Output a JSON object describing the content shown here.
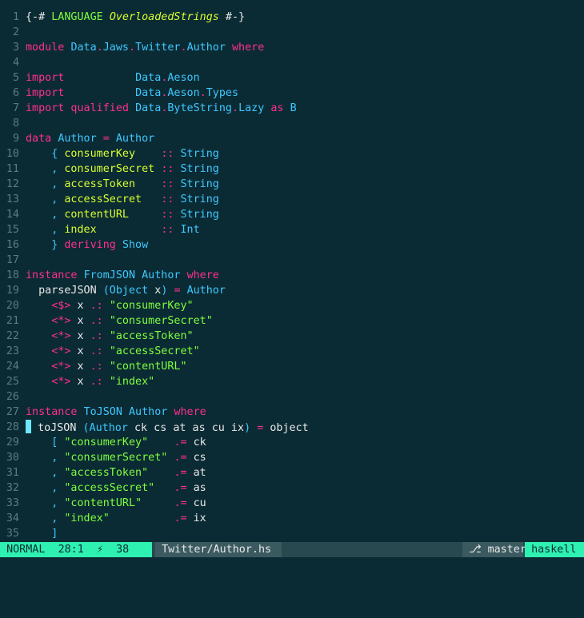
{
  "editor": {
    "lines": [
      {
        "n": "1",
        "html": "<span class=\"pr\">{-# </span><span class=\"str\">LANGUAGE</span><span class=\"pr\"> </span><span class=\"fld ital\">OverloadedStrings</span><span class=\"pr\"> #-}</span>"
      },
      {
        "n": "2",
        "html": ""
      },
      {
        "n": "3",
        "html": "<span class=\"kw\">module</span> <span class=\"ty\">Data</span><span class=\"kw\">.</span><span class=\"ty\">Jaws</span><span class=\"kw\">.</span><span class=\"ty\">Twitter</span><span class=\"kw\">.</span><span class=\"ty\">Author</span> <span class=\"kw\">where</span>"
      },
      {
        "n": "4",
        "html": ""
      },
      {
        "n": "5",
        "html": "<span class=\"kw\">import</span>           <span class=\"ty\">Data</span><span class=\"kw\">.</span><span class=\"ty\">Aeson</span>"
      },
      {
        "n": "6",
        "html": "<span class=\"kw\">import</span>           <span class=\"ty\">Data</span><span class=\"kw\">.</span><span class=\"ty\">Aeson</span><span class=\"kw\">.</span><span class=\"ty\">Types</span>"
      },
      {
        "n": "7",
        "html": "<span class=\"kw\">import qualified</span> <span class=\"ty\">Data</span><span class=\"kw\">.</span><span class=\"ty\">ByteString</span><span class=\"kw\">.</span><span class=\"ty\">Lazy</span> <span class=\"kw\">as</span> <span class=\"ty\">B</span>"
      },
      {
        "n": "8",
        "html": ""
      },
      {
        "n": "9",
        "html": "<span class=\"kw\">data</span> <span class=\"ty\">Author</span> <span class=\"kw\">=</span> <span class=\"ty\">Author</span>"
      },
      {
        "n": "10",
        "html": "    <span class=\"ty\">{</span> <span class=\"fld\">consumerKey</span>    <span class=\"kw\">::</span> <span class=\"ty\">String</span>"
      },
      {
        "n": "11",
        "html": "    <span class=\"ty\">,</span> <span class=\"fld\">consumerSecret</span> <span class=\"kw\">::</span> <span class=\"ty\">String</span>"
      },
      {
        "n": "12",
        "html": "    <span class=\"ty\">,</span> <span class=\"fld\">accessToken</span>    <span class=\"kw\">::</span> <span class=\"ty\">String</span>"
      },
      {
        "n": "13",
        "html": "    <span class=\"ty\">,</span> <span class=\"fld\">accessSecret</span>   <span class=\"kw\">::</span> <span class=\"ty\">String</span>"
      },
      {
        "n": "14",
        "html": "    <span class=\"ty\">,</span> <span class=\"fld\">contentURL</span>     <span class=\"kw\">::</span> <span class=\"ty\">String</span>"
      },
      {
        "n": "15",
        "html": "    <span class=\"ty\">,</span> <span class=\"fld\">index</span>          <span class=\"kw\">::</span> <span class=\"ty\">Int</span>"
      },
      {
        "n": "16",
        "html": "    <span class=\"ty\">}</span> <span class=\"kw\">deriving</span> <span class=\"ty\">Show</span>"
      },
      {
        "n": "17",
        "html": ""
      },
      {
        "n": "18",
        "html": "<span class=\"kw\">instance</span> <span class=\"ty\">FromJSON</span> <span class=\"ty\">Author</span> <span class=\"kw\">where</span>"
      },
      {
        "n": "19",
        "html": "  <span class=\"pr\">parseJSON</span> <span class=\"ty\">(Object</span> <span class=\"pr\">x</span><span class=\"ty\">)</span> <span class=\"kw\">=</span> <span class=\"ty\">Author</span>"
      },
      {
        "n": "20",
        "html": "    <span class=\"kw\">&lt;$&gt;</span> <span class=\"pr\">x</span> <span class=\"kw\">.:</span> <span class=\"str\">\"consumerKey\"</span>"
      },
      {
        "n": "21",
        "html": "    <span class=\"kw\">&lt;*&gt;</span> <span class=\"pr\">x</span> <span class=\"kw\">.:</span> <span class=\"str\">\"consumerSecret\"</span>"
      },
      {
        "n": "22",
        "html": "    <span class=\"kw\">&lt;*&gt;</span> <span class=\"pr\">x</span> <span class=\"kw\">.:</span> <span class=\"str\">\"accessToken\"</span>"
      },
      {
        "n": "23",
        "html": "    <span class=\"kw\">&lt;*&gt;</span> <span class=\"pr\">x</span> <span class=\"kw\">.:</span> <span class=\"str\">\"accessSecret\"</span>"
      },
      {
        "n": "24",
        "html": "    <span class=\"kw\">&lt;*&gt;</span> <span class=\"pr\">x</span> <span class=\"kw\">.:</span> <span class=\"str\">\"contentURL\"</span>"
      },
      {
        "n": "25",
        "html": "    <span class=\"kw\">&lt;*&gt;</span> <span class=\"pr\">x</span> <span class=\"kw\">.:</span> <span class=\"str\">\"index\"</span>"
      },
      {
        "n": "26",
        "html": ""
      },
      {
        "n": "27",
        "html": "<span class=\"kw\">instance</span> <span class=\"ty\">ToJSON</span> <span class=\"ty\">Author</span> <span class=\"kw\">where</span>"
      },
      {
        "n": "28",
        "html": "<span class=\"cursor\"></span> <span class=\"pr\">toJSON</span> <span class=\"ty\">(Author</span> <span class=\"pr\">ck cs at as cu ix</span><span class=\"ty\">)</span> <span class=\"kw\">=</span> <span class=\"pr\">object</span>"
      },
      {
        "n": "29",
        "html": "    <span class=\"ty\">[</span> <span class=\"str\">\"consumerKey\"</span>    <span class=\"kw\">.=</span> <span class=\"pr\">ck</span>"
      },
      {
        "n": "30",
        "html": "    <span class=\"ty\">,</span> <span class=\"str\">\"consumerSecret\"</span> <span class=\"kw\">.=</span> <span class=\"pr\">cs</span>"
      },
      {
        "n": "31",
        "html": "    <span class=\"ty\">,</span> <span class=\"str\">\"accessToken\"</span>    <span class=\"kw\">.=</span> <span class=\"pr\">at</span>"
      },
      {
        "n": "32",
        "html": "    <span class=\"ty\">,</span> <span class=\"str\">\"accessSecret\"</span>   <span class=\"kw\">.=</span> <span class=\"pr\">as</span>"
      },
      {
        "n": "33",
        "html": "    <span class=\"ty\">,</span> <span class=\"str\">\"contentURL\"</span>     <span class=\"kw\">.=</span> <span class=\"pr\">cu</span>"
      },
      {
        "n": "34",
        "html": "    <span class=\"ty\">,</span> <span class=\"str\">\"index\"</span>          <span class=\"kw\">.=</span> <span class=\"pr\">ix</span>"
      },
      {
        "n": "35",
        "html": "    <span class=\"ty\">]</span>"
      }
    ]
  },
  "status": {
    "mode": "NORMAL",
    "position": "28:1",
    "bolt": "⚡",
    "percent": "38",
    "file": "Twitter/Author.hs",
    "branch_icon": "⎇",
    "branch": "master",
    "filetype": "haskell"
  },
  "colors": {
    "background": "#0b2b34",
    "keyword": "#ff2f8f",
    "type": "#3ec8ff",
    "string": "#7fff3f",
    "field": "#d8ff30",
    "status_accent": "#2ef0b0"
  }
}
